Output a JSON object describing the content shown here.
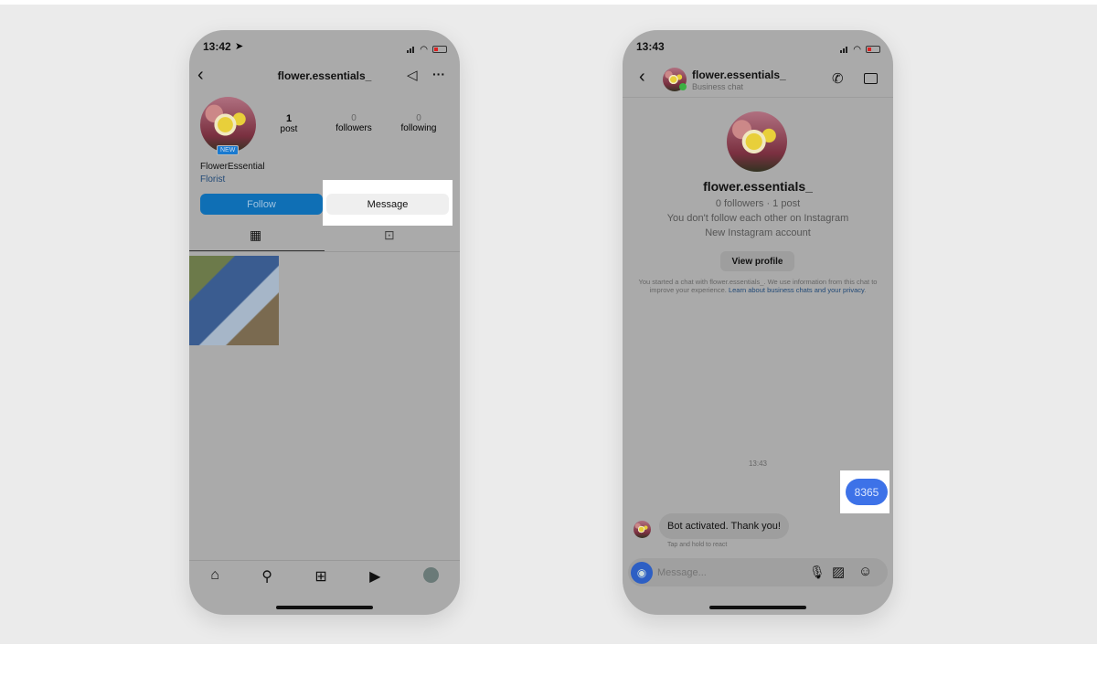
{
  "left_phone": {
    "time": "13:42",
    "username": "flower.essentials_",
    "stats": [
      {
        "value": "1",
        "label": "post"
      },
      {
        "value": "0",
        "label": "followers"
      },
      {
        "value": "0",
        "label": "following"
      }
    ],
    "new_badge": "NEW",
    "display_name": "FlowerEssential",
    "category": "Florist",
    "follow_label": "Follow",
    "message_label": "Message",
    "colors": {
      "follow": "#0f6fb5",
      "highlight": "#ffffff"
    }
  },
  "right_phone": {
    "time": "13:43",
    "username": "flower.essentials_",
    "subtitle": "Business chat",
    "profile_name": "flower.essentials_",
    "profile_stats": "0 followers · 1 post",
    "follow_note": "You don't follow each other on Instagram",
    "account_note": "New Instagram account",
    "view_profile": "View profile",
    "disclaimer": "You started a chat with flower.essentials_. We use information from this chat to improve your experience.",
    "disclaimer_link": "Learn about business chats and your privacy",
    "timestamp": "13:43",
    "sent_message": "8365",
    "received_message": "Bot activated. Thank you!",
    "react_hint": "Tap and hold to react",
    "input_placeholder": "Message...",
    "colors": {
      "sent_bubble": "#3d72e8",
      "online": "#3cb043"
    }
  }
}
